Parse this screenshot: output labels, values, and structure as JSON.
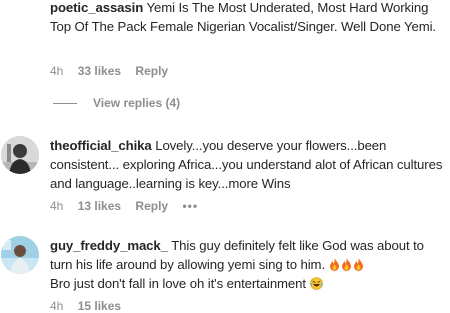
{
  "comments": [
    {
      "username": "poetic_assasin",
      "text": "Yemi Is The Most Underated, Most Hard Working Top Of The Pack Female Nigerian Vocalist/Singer. Well Done Yemi.",
      "time": "4h",
      "likes": "33 likes",
      "reply": "Reply",
      "view_replies": "View replies (4)"
    },
    {
      "username": "theofficial_chika",
      "text": "Lovely...you deserve your flowers...been consistent... exploring Africa...you understand alot of African cultures and language..learning is key...more Wins",
      "time": "4h",
      "likes": "13 likes",
      "reply": "Reply",
      "more": "•••"
    },
    {
      "username": "guy_freddy_mack_",
      "text": "This guy definitely felt like God was about to turn his life around by allowing yemi sing to him.",
      "text2": "Bro just don't fall in love oh it's entertainment",
      "emoji_fire": "fire-emoji",
      "emoji_laugh": "laughing-emoji",
      "time": "4h",
      "likes": "15 likes"
    }
  ],
  "colors": {
    "text": "#262626",
    "secondary": "#8e8e8e",
    "fire": "#f26b1d"
  }
}
